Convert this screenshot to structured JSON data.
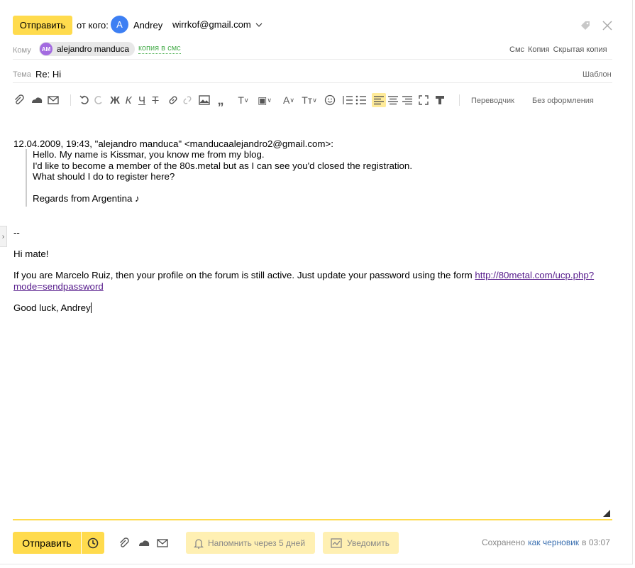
{
  "header": {
    "send_label": "Отправить",
    "from_label": "от кого:",
    "sender_initial": "A",
    "sender_name": "Andrey",
    "sender_email": "wirrkof@gmail.com"
  },
  "to": {
    "label": "Кому",
    "recipient_initials": "AM",
    "recipient_name": "alejandro manduca",
    "copy_sms": "копия в смс",
    "links": [
      "Смс",
      "Копия",
      "Скрытая копия"
    ]
  },
  "subject": {
    "label": "Тема",
    "value": "Re: Hi",
    "template_label": "Шаблон"
  },
  "toolbar": {
    "translator": "Переводчик",
    "no_format": "Без оформления"
  },
  "body": {
    "quote_header": "12.04.2009, 19:43, \"alejandro manduca\" <manducaalejandro2@gmail.com>:",
    "quote_lines": [
      "Hello. My name is Kissmar, you know me from my blog.",
      "I'd like to become a member of the 80s.metal but as I can see you'd closed the registration.",
      "What should I do to register here?",
      "Regards from Argentina ♪"
    ],
    "signature_sep": "--",
    "greeting": "Hi mate!",
    "para_text": "If you are Marcelo Ruiz, then your profile on the forum is still active. Just update your password using the form ",
    "link_text": "http://80metal.com/ucp.php?mode=sendpassword",
    "closing": "Good luck, Andrey"
  },
  "footer": {
    "send_label": "Отправить",
    "remind_label": "Напомнить через 5 дней",
    "notify_label": "Уведомить",
    "saved_prefix": "Сохранено",
    "saved_link": "как черновик",
    "saved_suffix": "в 03:07"
  },
  "colors": {
    "accent_yellow": "#ffdb4d",
    "avatar_blue": "#3d7ff3",
    "avatar_purple": "#a36be0",
    "copy_sms_green": "#4caf50",
    "link_purple": "#551a8b"
  }
}
